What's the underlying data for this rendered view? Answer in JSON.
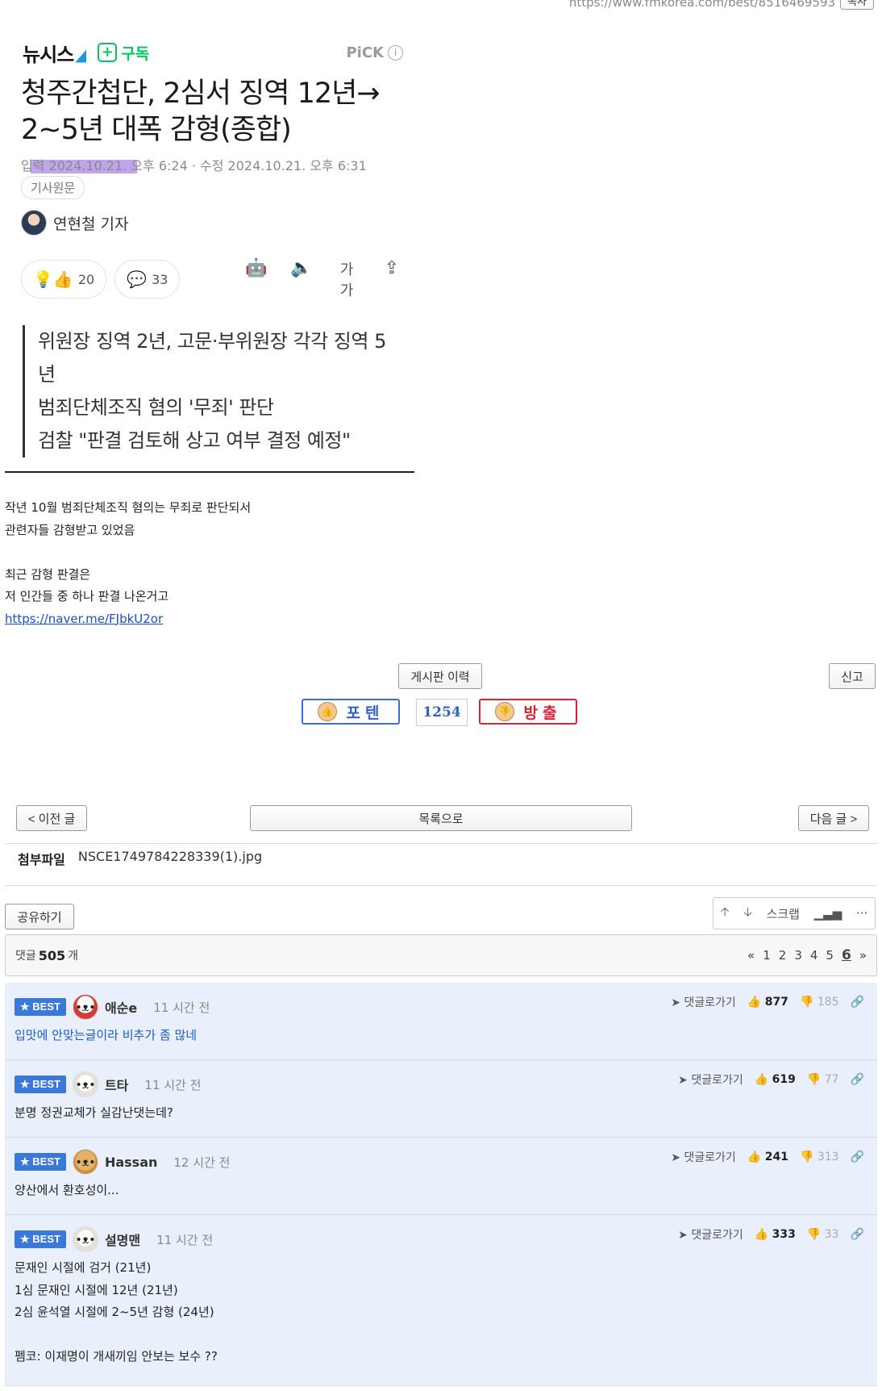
{
  "url_bar": {
    "url": "https://www.fmkorea.com/best/8516469593",
    "copy_label": "복사"
  },
  "article": {
    "brand": "뉴시스",
    "subscribe_label": "구독",
    "pick_label": "PiCK",
    "headline": "청주간첩단, 2심서 징역 12년→ 2~5년 대폭 감형(종합)",
    "dates": "입력 2024.10.21. 오후 6:24 · 수정 2024.10.21. 오후 6:31",
    "original_tag": "기사원문",
    "reporter": "연현철 기자",
    "reaction_count": "20",
    "comment_count": "33",
    "font_size_label": "가가",
    "summary": [
      "위원장 징역 2년, 고문·부위원장 각각 징역 5년",
      "범죄단체조직 혐의 '무죄' 판단",
      "검찰 \"판결 검토해 상고 여부 결정 예정\""
    ]
  },
  "post_body": {
    "lines": [
      "작년 10월 범죄단체조직 혐의는 무죄로 판단되서",
      "관련자들 감형받고 있었음",
      "",
      "최근 감형 판결은",
      "저 인간들 중 하나 판결 나온거고"
    ],
    "link": "https://naver.me/FJbkU2or"
  },
  "buttons": {
    "history": "게시판 이력",
    "report": "신고",
    "vote_up": "포텐",
    "vote_count": "1254",
    "vote_down": "방출",
    "prev": "< 이전 글",
    "list": "목록으로",
    "next": "다음 글 >",
    "share": "공유하기",
    "scrap": "스크랩"
  },
  "attachment": {
    "label": "첨부파일",
    "filename": "NSCE1749784228339(1).jpg"
  },
  "comments_header": {
    "prefix": "댓글",
    "count": "505",
    "suffix": "개",
    "pages": [
      "1",
      "2",
      "3",
      "4",
      "5",
      "6"
    ],
    "current_page": "6"
  },
  "comments": [
    {
      "badge": "BEST",
      "nick": "애순e",
      "time": "11 시간 전",
      "reply": "댓글로가기",
      "up": "877",
      "down": "185",
      "lines": [
        "입맛에 안맞는글이라 비추가 좀 많네"
      ]
    },
    {
      "badge": "BEST",
      "nick": "트타",
      "time": "11 시간 전",
      "reply": "댓글로가기",
      "up": "619",
      "down": "77",
      "lines": [
        "분명 정권교체가 실감난댓는데?"
      ]
    },
    {
      "badge": "BEST",
      "nick": "Hassan",
      "time": "12 시간 전",
      "reply": "댓글로가기",
      "up": "241",
      "down": "313",
      "lines": [
        "양산에서 환호성이..."
      ]
    },
    {
      "badge": "BEST",
      "nick": "설명맨",
      "time": "11 시간 전",
      "reply": "댓글로가기",
      "up": "333",
      "down": "33",
      "lines": [
        "문재인 시절에 검거 (21년)",
        "1심 문재인 시절에 12년 (21년)",
        "2심 윤석열 시절에 2~5년 감형 (24년)",
        "",
        "펨코: 이재명이 개새끼임 안보는 보수 ??"
      ]
    }
  ]
}
